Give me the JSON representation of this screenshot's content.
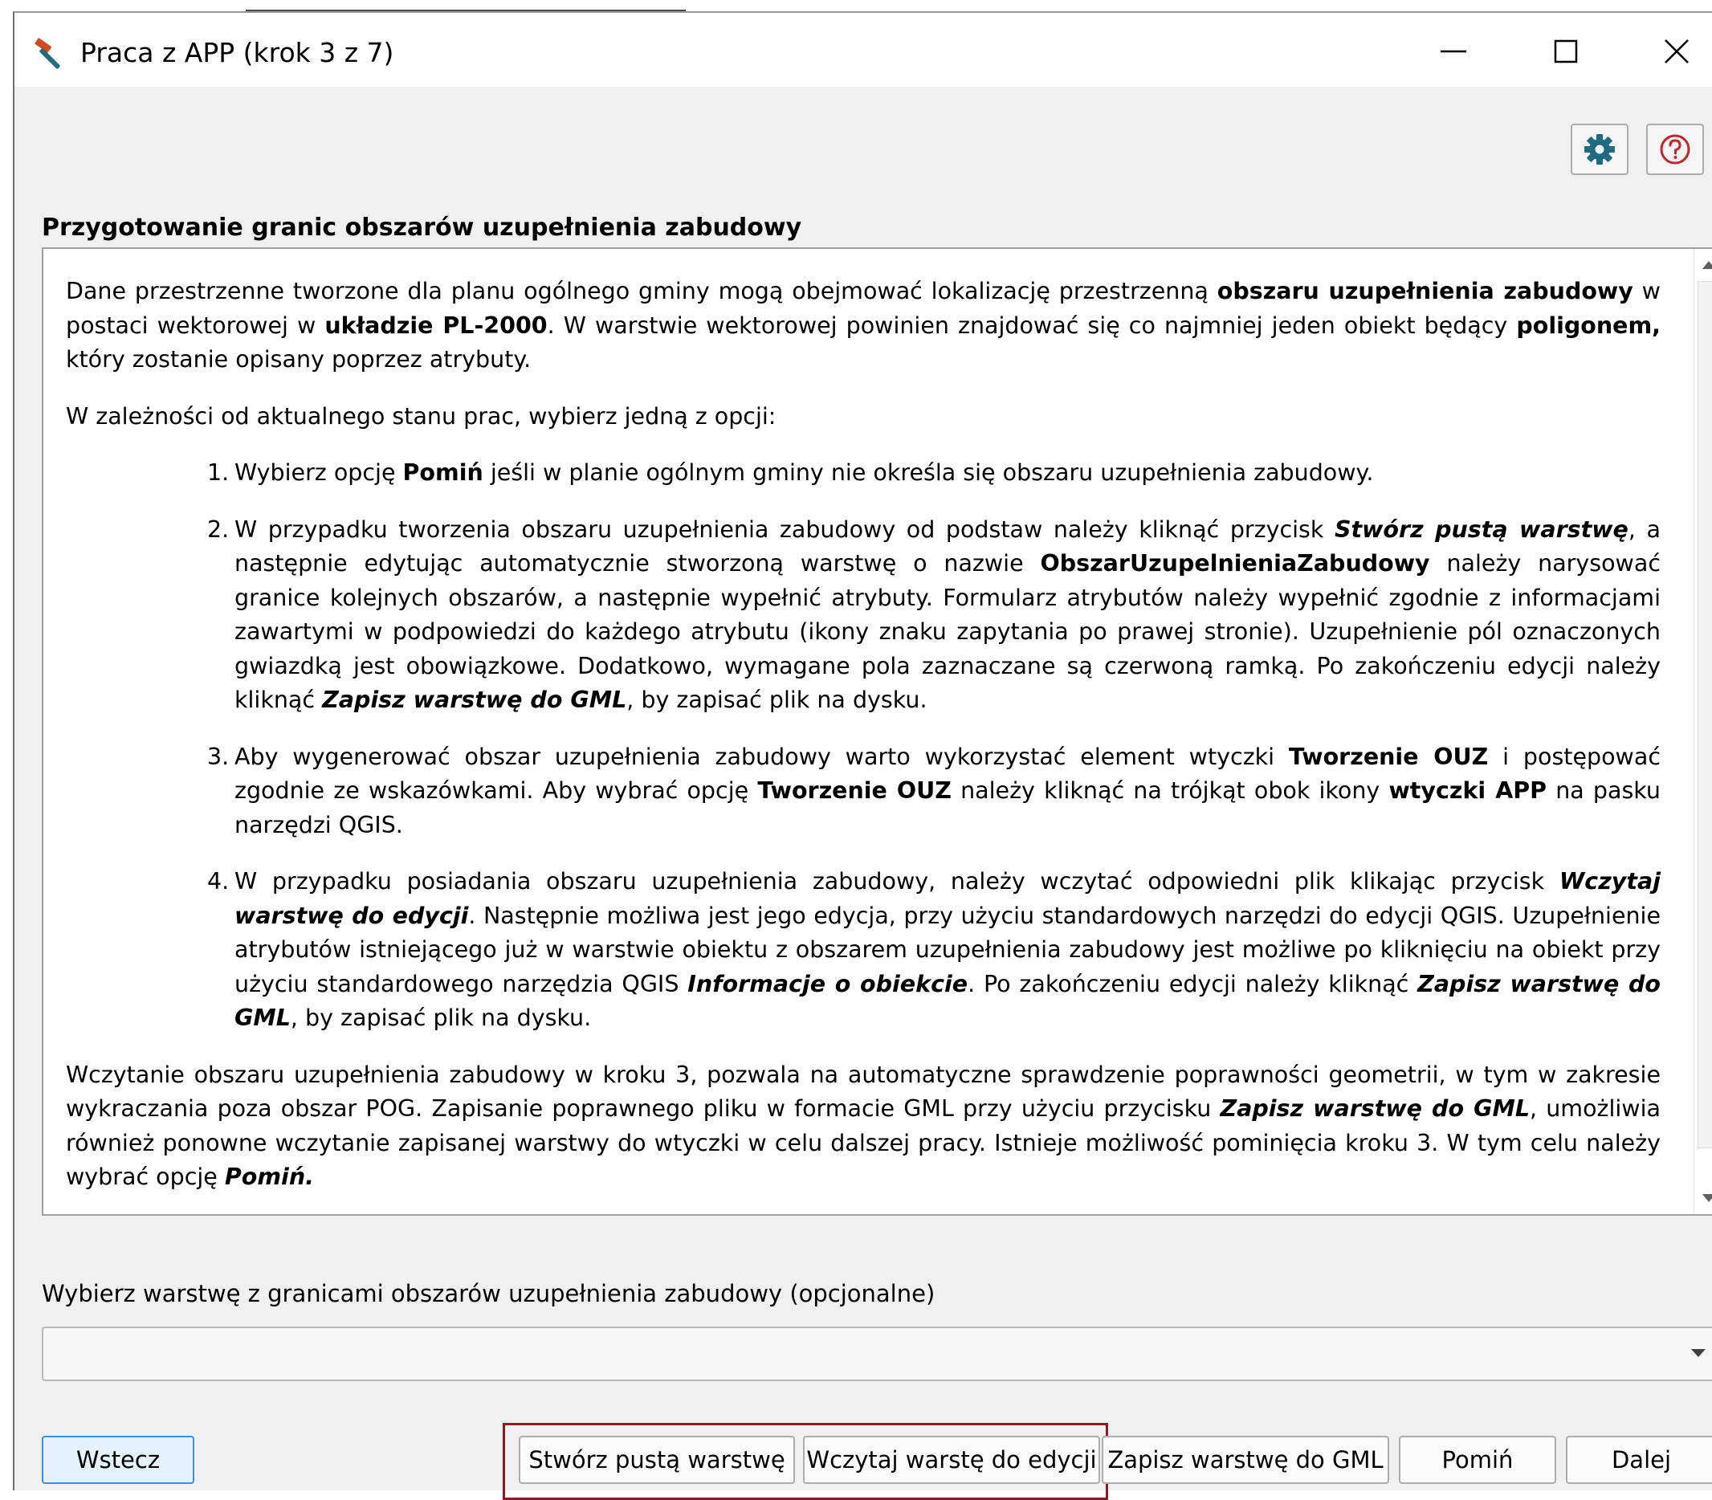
{
  "window": {
    "title": "Praca z APP (krok 3 z 7)"
  },
  "section": {
    "heading": "Przygotowanie granic obszarów uzupełnienia zabudowy"
  },
  "info": {
    "p1": {
      "a": "Dane przestrzenne tworzone dla planu ogólnego gminy mogą obejmować lokalizację przestrzenną ",
      "b": "obszaru uzupełnienia zabudowy",
      "c": " w postaci wektorowej w ",
      "d": "układzie PL-2000",
      "e": ". W warstwie wektorowej powinien znajdować się co najmniej jeden obiekt będący ",
      "f": "poligonem,",
      "g": " który zostanie opisany poprzez atrybuty."
    },
    "p2": "W zależności od aktualnego stanu prac, wybierz jedną z opcji:",
    "item1": {
      "num": "1.",
      "a": "Wybierz opcję ",
      "b": "Pomiń",
      "c": " jeśli w planie ogólnym gminy nie określa się obszaru uzupełnienia zabudowy."
    },
    "item2": {
      "num": "2.",
      "a": "W przypadku tworzenia obszaru uzupełnienia zabudowy od podstaw należy kliknąć przycisk  ",
      "b": "Stwórz pustą warstwę",
      "c": ", a następnie edytując automatycznie stworzoną warstwę o nazwie ",
      "d": "ObszarUzupelnieniaZabudowy",
      "e": " należy narysować granice kolejnych obszarów, a następnie wypełnić atrybuty. Formularz atrybutów należy wypełnić zgodnie z informacjami zawartymi w podpowiedzi do każdego atrybutu (ikony znaku zapytania po prawej stronie).  Uzupełnienie pól oznaczonych gwiazdką jest obowiązkowe. Dodatkowo, wymagane pola zaznaczane są czerwoną ramką. Po zakończeniu edycji należy kliknąć ",
      "f": "Zapisz warstwę do GML",
      "g": ", by zapisać plik na dysku."
    },
    "item3": {
      "num": "3.",
      "a": "Aby wygenerować obszar uzupełnienia zabudowy warto wykorzystać element wtyczki ",
      "b": "Tworzenie OUZ",
      "c": " i postępować zgodnie ze wskazówkami. Aby wybrać opcję ",
      "d": "Tworzenie OUZ",
      "e": " należy kliknąć na trójkąt obok ikony ",
      "f": "wtyczki APP",
      "g": " na pasku narzędzi QGIS."
    },
    "item4": {
      "num": "4.",
      "a": "W przypadku posiadania obszaru uzupełnienia zabudowy, należy wczytać odpowiedni plik klikając przycisk ",
      "b": "Wczytaj warstwę do edycji",
      "c": ". Następnie możliwa jest jego edycja, przy użyciu standardowych narzędzi do edycji QGIS. Uzupełnienie atrybutów istniejącego już w warstwie obiektu z obszarem uzupełnienia zabudowy jest możliwe po kliknięciu na obiekt przy użyciu standardowego narzędzia QGIS ",
      "d": "Informacje o obiekcie",
      "e": ". Po zakończeniu edycji należy kliknąć ",
      "f": "Zapisz warstwę do GML",
      "g": ", by zapisać plik na dysku."
    },
    "p3": {
      "a": "Wczytanie obszaru uzupełnienia zabudowy w kroku 3, pozwala na automatyczne sprawdzenie poprawności geometrii, w tym w zakresie wykraczania poza obszar POG. Zapisanie poprawnego pliku w formacie GML przy użyciu przycisku ",
      "b": "Zapisz warstwę do GML",
      "c": ", umożliwia również ponowne wczytanie zapisanej warstwy do wtyczki w celu dalszej pracy. Istnieje możliwość pominięcia kroku 3. W tym celu należy wybrać opcję ",
      "d": "Pomiń."
    }
  },
  "layer_select": {
    "label": "Wybierz warstwę z granicami obszarów uzupełnienia zabudowy (opcjonalne)",
    "value": ""
  },
  "buttons": {
    "back": "Wstecz",
    "create": "Stwórz pustą warstwę",
    "load": "Wczytaj warstę do edycji",
    "save": "Zapisz warstwę do GML",
    "skip": "Pomiń",
    "next": "Dalej"
  },
  "colors": {
    "highlight_border": "#8b1c24",
    "back_button_bg": "#e5f1fb",
    "settings_icon": "#1f6b80",
    "help_icon": "#c0272d",
    "app_icon": "#d04a1f"
  },
  "icons": {
    "app": "hammer-icon",
    "minimize": "minimize-icon",
    "maximize": "maximize-icon",
    "close": "close-icon",
    "settings": "gear-icon",
    "help": "help-icon"
  }
}
